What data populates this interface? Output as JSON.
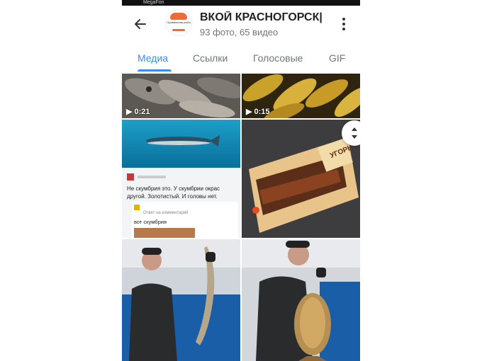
{
  "status": {
    "carrier": "MegaFon"
  },
  "header": {
    "avatar_text": "Правильная рыба",
    "title": "ВКОЙ КРАСНОГОРСК|",
    "subtitle": "93 фото, 65 видео"
  },
  "tabs": [
    {
      "label": "Медиа",
      "active": true
    },
    {
      "label": "Ссылки",
      "active": false
    },
    {
      "label": "Голосовые",
      "active": false
    },
    {
      "label": "GIF",
      "active": false
    }
  ],
  "media": {
    "items": [
      {
        "type": "video",
        "duration": "0:21",
        "subject": "dried fish"
      },
      {
        "type": "video",
        "duration": "0:15",
        "subject": "smoked golden fish"
      },
      {
        "type": "photo",
        "subject": "mackerel screenshot with comment"
      },
      {
        "type": "photo",
        "subject": "packaged smoked eel"
      },
      {
        "type": "photo",
        "subject": "man holding sturgeon"
      },
      {
        "type": "photo",
        "subject": "man holding carp"
      }
    ],
    "screenshot_post": {
      "text": "Не скумбрия это. У скумбрии окрас другой. Золотистый. И головы нет.",
      "reply_meta": "Ответ на комментарий",
      "reply_text": "вот скумбрия"
    },
    "package_label": "УГОРЬ"
  },
  "colors": {
    "accent": "#3390ec",
    "muted": "#707579"
  }
}
